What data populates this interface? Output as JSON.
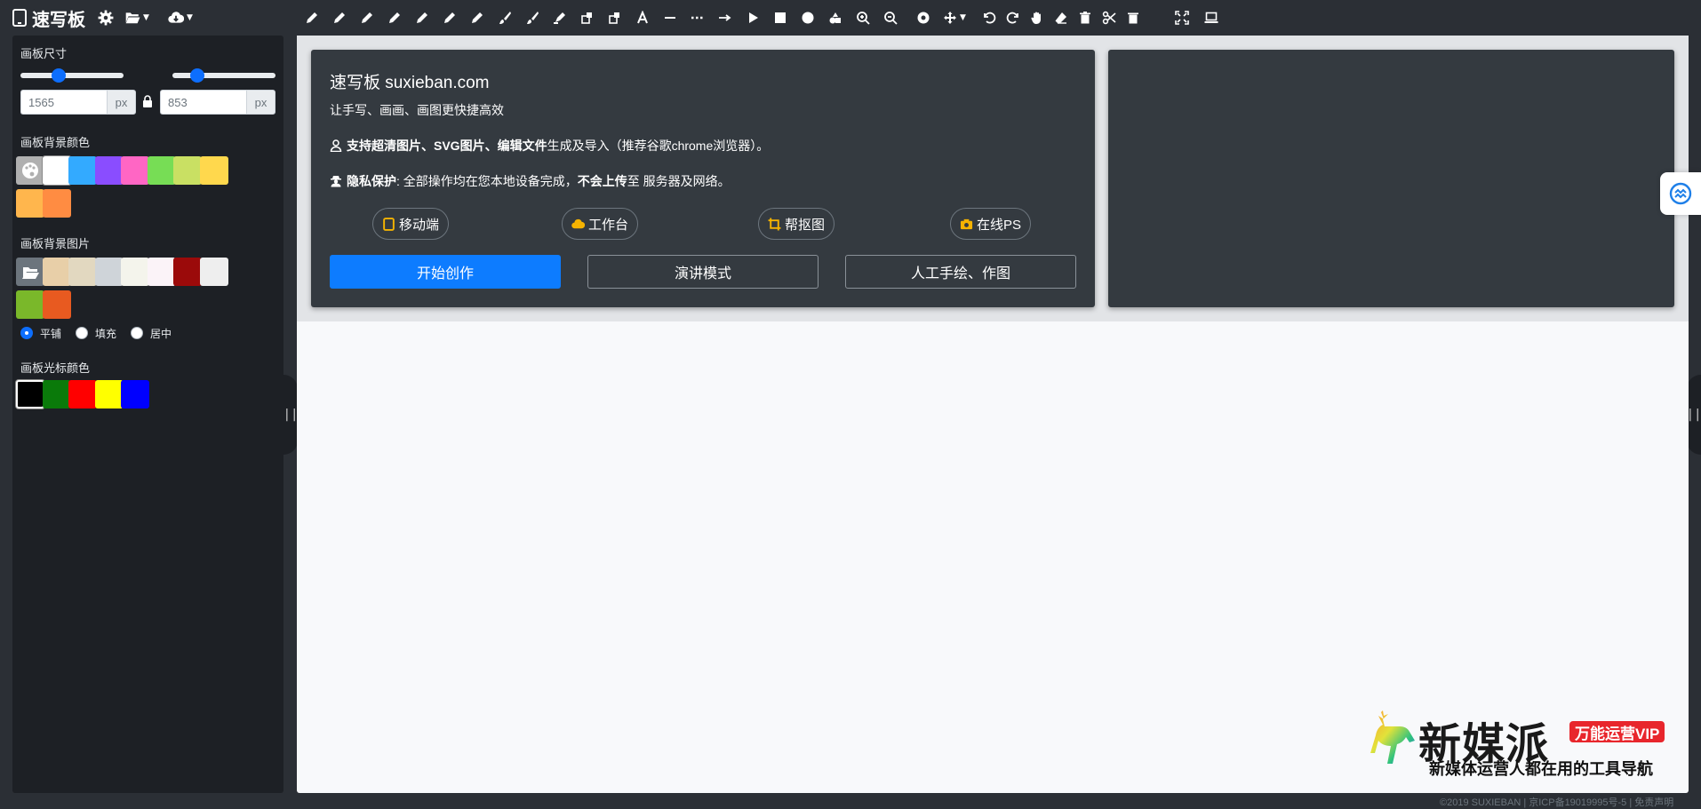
{
  "app": {
    "title": "速写板"
  },
  "toolbar": {
    "settings_icon": "gear-icon",
    "open_icon": "folder-open-icon",
    "cloud_icon": "cloud-download-icon",
    "tools": [
      "pencil-icon",
      "pencil-icon",
      "pencil-icon",
      "pencil-icon",
      "pencil-icon",
      "pencil-icon",
      "pencil-icon",
      "brush-icon",
      "brush-icon",
      "marker-icon",
      "shapes-icon",
      "shapes-icon",
      "text-icon",
      "line-icon",
      "dashed-line-icon",
      "arrow-icon",
      "triangle-icon",
      "square-icon",
      "circle-icon",
      "fill-icon",
      "zoom-in-icon",
      "zoom-out-icon",
      "target-icon",
      "move-icon",
      "undo-icon",
      "redo-icon",
      "hand-icon",
      "eraser-icon",
      "trash-icon",
      "scissors-icon",
      "delete-icon",
      "fullscreen-icon",
      "laptop-icon"
    ]
  },
  "left": {
    "size_title": "画板尺寸",
    "width_value": "1565",
    "height_value": "853",
    "unit": "px",
    "width_slider_pct": 0.35,
    "height_slider_pct": 0.2,
    "bg_color_title": "画板背景颜色",
    "bg_colors": [
      "#b0b0b0",
      "#ffffff",
      "#33aaff",
      "#8a4dff",
      "#ff66c4",
      "#77dd55",
      "#c9e063",
      "#ffd84d",
      "#ffb64d",
      "#ff8c42"
    ],
    "bg_image_title": "画板背景图片",
    "bg_images": [
      "#6c757d",
      "#e8cfa8",
      "#e2d8c0",
      "#cfd4d9",
      "#f4f4ec",
      "#fbf3f8",
      "#9b0a0a",
      "#eeeeee",
      "#7ab82a",
      "#e85a20"
    ],
    "fill_modes": [
      "平铺",
      "填充",
      "居中"
    ],
    "cursor_color_title": "画板光标颜色",
    "cursor_colors": [
      "#000000",
      "#0a7a0a",
      "#ff0000",
      "#ffff00",
      "#0000ff"
    ]
  },
  "card": {
    "title": "速写板 suxieban.com",
    "subtitle": "让手写、画画、画图更快捷高效",
    "line1_bold": "支持超清图片、SVG图片、编辑文件",
    "line1_rest": "生成及导入（推荐谷歌chrome浏览器）。",
    "line2_bold": "隐私保护",
    "line2_mid": ": 全部操作均在您本地设备完成，",
    "line2_bold2": "不会上传",
    "line2_rest": " 至 服务器及网络。",
    "pills": [
      "移动端",
      "工作台",
      "帮抠图",
      "在线PS"
    ],
    "start_btn": "开始创作",
    "present_btn": "演讲模式",
    "manual_btn": "人工手绘、作图"
  },
  "watermark": {
    "name": "新媒派",
    "badge": "万能运营VIP",
    "slogan": "新媒体运营人都在用的工具导航"
  },
  "footer": "©2019 SUXIEBAN | 京ICP备19019995号-5 | 免责声明"
}
